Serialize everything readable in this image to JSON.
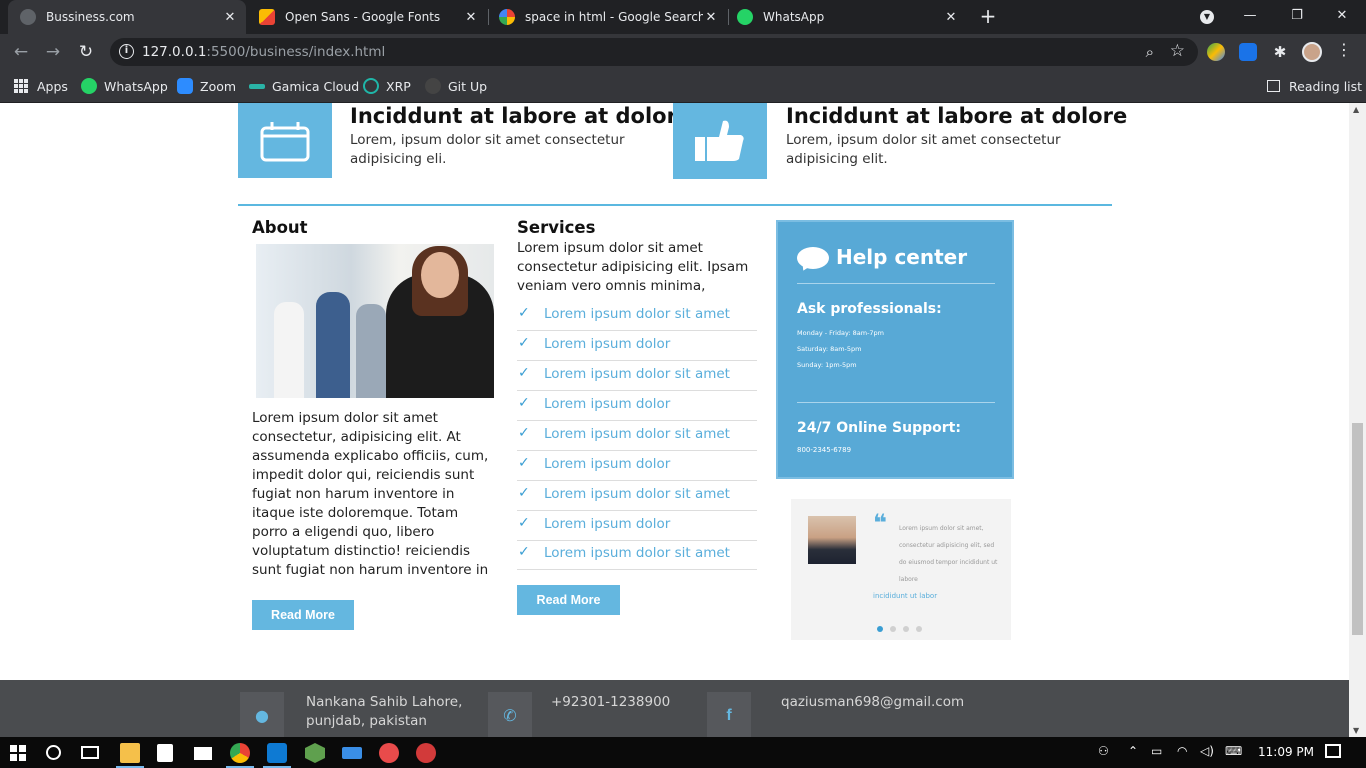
{
  "browser": {
    "tabs": [
      {
        "title": "Bussiness.com",
        "active": true,
        "icon_color": "#5f6368"
      },
      {
        "title": "Open Sans - Google Fonts",
        "active": false,
        "icon_color": "#fbbc04"
      },
      {
        "title": "space in html - Google Search",
        "active": false,
        "icon_color": "#4285f4"
      },
      {
        "title": "WhatsApp",
        "active": false,
        "icon_color": "#25d366"
      }
    ],
    "url_host": "127.0.0.1",
    "url_path": ":5500/business/index.html",
    "bookmarks": [
      {
        "label": "Apps",
        "icon": "apps-icon"
      },
      {
        "label": "WhatsApp",
        "icon": "whatsapp-icon",
        "color": "#25d366"
      },
      {
        "label": "Zoom",
        "icon": "zoom-icon",
        "color": "#2d8cff"
      },
      {
        "label": "Gamica Cloud",
        "icon": "gamica-icon",
        "color": "#2ab3a6"
      },
      {
        "label": "XRP",
        "icon": "xrp-icon",
        "color": "#1fb6a8"
      },
      {
        "label": "Git Up",
        "icon": "github-icon",
        "color": "#444444"
      }
    ],
    "reading_list": "Reading list"
  },
  "page": {
    "features": [
      {
        "title": "Inciddunt at labore at dolore",
        "text": "Lorem, ipsum dolor sit amet consectetur adipisicing eli.",
        "icon": "calendar-icon"
      },
      {
        "title": "Inciddunt at labore at dolore",
        "text": "Lorem, ipsum dolor sit amet consectetur adipisicing elit.",
        "icon": "thumbs-up-icon"
      }
    ],
    "about": {
      "title": "About",
      "text": "Lorem ipsum dolor sit amet consectetur, adipisicing elit. At assumenda explicabo officiis, cum, impedit dolor qui, reiciendis sunt fugiat non harum inventore in itaque iste doloremque. Totam porro a eligendi quo, libero voluptatum distinctio! reiciendis sunt fugiat non harum inventore in",
      "button": "Read More"
    },
    "services": {
      "title": "Services",
      "text": "Lorem ipsum dolor sit amet consectetur adipisicing elit. Ipsam veniam vero omnis minima,",
      "items": [
        "Lorem ipsum dolor sit amet",
        "Lorem ipsum dolor",
        "Lorem ipsum dolor sit amet",
        "Lorem ipsum dolor",
        "Lorem ipsum dolor sit amet",
        "Lorem ipsum dolor",
        "Lorem ipsum dolor sit amet",
        "Lorem ipsum dolor",
        "Lorem ipsum dolor sit amet"
      ],
      "button": "Read More"
    },
    "help_center": {
      "title": "Help center",
      "ask": "Ask professionals:",
      "hours": [
        "Monday - Friday: 8am-7pm",
        "Saturday: 8am-5pm",
        "Sunday: 1pm-5pm"
      ],
      "support": "24/7 Online Support:",
      "phone": "800-2345-6789"
    },
    "testimonial": {
      "text": "Lorem ipsum dolor sit amet, consectetur adipisicing elit, sed do eiusmod tempor incididunt ut labore",
      "author": "incididunt ut labor"
    },
    "footer": {
      "address": "Nankana Sahib Lahore, punjdab, pakistan",
      "phone": "+92301-1238900",
      "email": "qaziusman698@gmail.com"
    }
  },
  "taskbar": {
    "time": "11:09 PM"
  },
  "colors": {
    "accent": "#64b7e0",
    "link": "#5aaedb",
    "footer": "#4a4c4f",
    "chrome_dark": "#202124",
    "chrome": "#35363a"
  }
}
